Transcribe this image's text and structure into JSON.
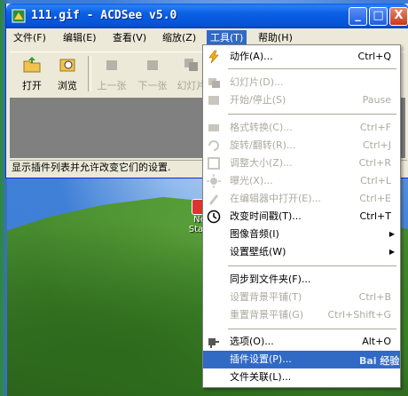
{
  "window": {
    "title": "111.gif - ACDSee v5.0",
    "controls": {
      "minimize": "_",
      "maximize": "□",
      "close": "X"
    }
  },
  "menubar": [
    {
      "label": "文件(F)"
    },
    {
      "label": "编辑(E)"
    },
    {
      "label": "查看(V)"
    },
    {
      "label": "缩放(Z)"
    },
    {
      "label": "工具(T)"
    },
    {
      "label": "帮助(H)"
    }
  ],
  "toolbar": [
    {
      "label": "打开",
      "icon": "open-folder-icon"
    },
    {
      "label": "浏览",
      "icon": "browse-icon"
    },
    {
      "label": "上一张",
      "icon": "previous-image-icon"
    },
    {
      "label": "下一张",
      "icon": "next-image-icon"
    },
    {
      "label": "幻灯片",
      "icon": "slideshow-icon"
    }
  ],
  "statusbar": {
    "text": "显示插件列表并允许改变它们的设置."
  },
  "desktop": {
    "icon_label": "Ne",
    "icon_label2": "Start"
  },
  "tools_menu": {
    "items": [
      {
        "label": "动作(A)...",
        "shortcut": "Ctrl+Q",
        "icon": "lightning-icon"
      },
      {
        "label": "幻灯片(D)...",
        "shortcut": "",
        "icon": "slideshow-icon"
      },
      {
        "label": "开始/停止(S)",
        "shortcut": "Pause",
        "icon": "play-icon"
      },
      {
        "label": "格式转换(C)...",
        "shortcut": "Ctrl+F",
        "icon": "convert-icon"
      },
      {
        "label": "旋转/翻转(R)...",
        "shortcut": "Ctrl+J",
        "icon": "rotate-icon"
      },
      {
        "label": "调整大小(Z)...",
        "shortcut": "Ctrl+R",
        "icon": "resize-icon"
      },
      {
        "label": "曝光(X)...",
        "shortcut": "Ctrl+L",
        "icon": "exposure-icon"
      },
      {
        "label": "在编辑器中打开(E)...",
        "shortcut": "Ctrl+E",
        "icon": "editor-icon"
      },
      {
        "label": "改变时间戳(T)...",
        "shortcut": "Ctrl+T",
        "icon": "clock-icon"
      },
      {
        "label": "图像音频(I)",
        "shortcut": "",
        "icon": ""
      },
      {
        "label": "设置壁纸(W)",
        "shortcut": "",
        "icon": ""
      },
      {
        "label": "同步到文件夹(F)...",
        "shortcut": "",
        "icon": ""
      },
      {
        "label": "设置背景平铺(T)",
        "shortcut": "Ctrl+B",
        "icon": ""
      },
      {
        "label": "重置背景平铺(G)",
        "shortcut": "Ctrl+Shift+G",
        "icon": ""
      },
      {
        "label": "选项(O)...",
        "shortcut": "Alt+O",
        "icon": "tools-icon"
      },
      {
        "label": "插件设置(P)...",
        "shortcut": "",
        "icon": ""
      },
      {
        "label": "文件关联(L)...",
        "shortcut": "",
        "icon": ""
      }
    ]
  },
  "watermark": "Bai 经验"
}
